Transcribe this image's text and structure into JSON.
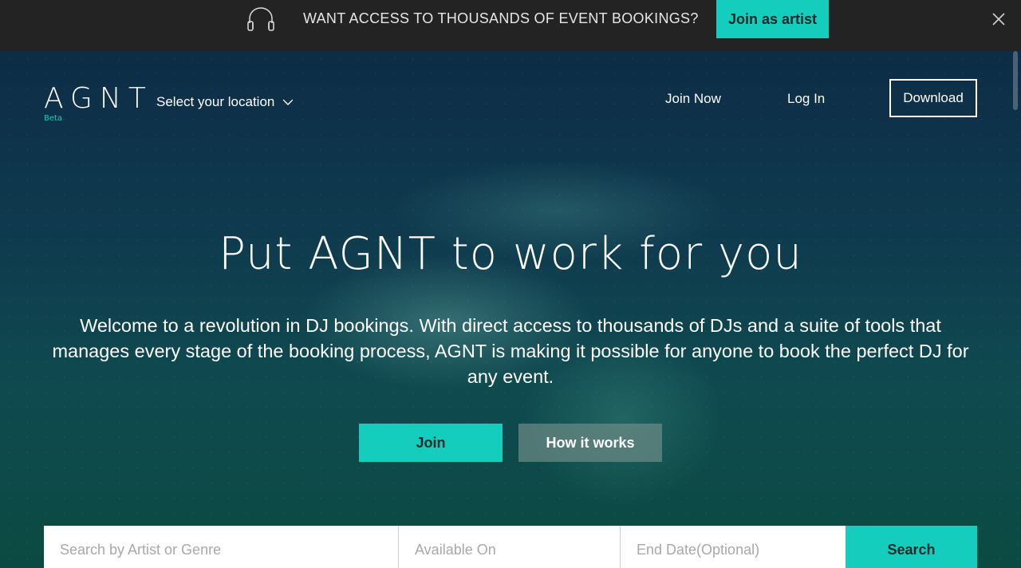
{
  "banner": {
    "message": "WANT ACCESS TO THOUSANDS OF EVENT BOOKINGS?",
    "join_artist_label": "Join as artist",
    "icon": "headphones-icon",
    "close_icon": "close-icon"
  },
  "header": {
    "logo_text": "AGNT",
    "beta_label": "Beta",
    "location_label": "Select your location",
    "nav": {
      "join_now": "Join Now",
      "log_in": "Log In",
      "download": "Download"
    }
  },
  "hero": {
    "headline": "Put AGNT to work for you",
    "subtext": "Welcome to a revolution in DJ bookings. With direct access to thousands of DJs and a suite of tools that manages every stage of the booking process, AGNT is making it possible for anyone to book the perfect DJ for any event.",
    "join_label": "Join",
    "how_label": "How it works"
  },
  "search": {
    "artist_placeholder": "Search by Artist or Genre",
    "available_placeholder": "Available On",
    "end_date_placeholder": "End Date(Optional)",
    "button_label": "Search"
  },
  "colors": {
    "accent": "#14cdbd",
    "banner_bg": "#232323",
    "hero_bg": "#0f3a4e"
  }
}
